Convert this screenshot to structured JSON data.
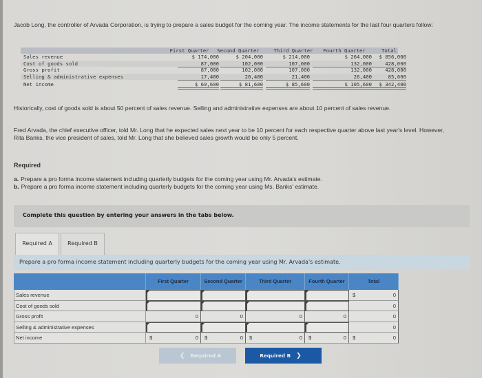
{
  "intro": "Jacob Long, the controller of Arvada Corporation, is trying to prepare a sales budget for the coming year. The income statements for the last four quarters follow:",
  "history_table": {
    "headers": [
      "First Quarter",
      "Second Quarter",
      "Third Quarter",
      "Fourth Quarter",
      "Total"
    ],
    "rows": [
      {
        "label": "Sales revenue",
        "values": [
          "$ 174,000",
          "$ 204,000",
          "$ 214,000",
          "$ 264,000",
          "$ 856,000"
        ]
      },
      {
        "label": "Cost of goods sold",
        "values": [
          "87,000",
          "102,000",
          "107,000",
          "132,000",
          "428,000"
        ]
      },
      {
        "label": "Gross profit",
        "values": [
          "87,000",
          "102,000",
          "107,000",
          "132,000",
          "428,000"
        ]
      },
      {
        "label": "Selling & administrative expenses",
        "values": [
          "17,400",
          "20,400",
          "21,400",
          "26,400",
          "85,600"
        ]
      },
      {
        "label": "Net income",
        "values": [
          "$ 69,600",
          "$ 81,600",
          "$ 85,600",
          "$ 105,600",
          "$ 342,400"
        ]
      }
    ]
  },
  "historical_note": "Historically, cost of goods sold is about 50 percent of sales revenue. Selling and administrative expenses are about 10 percent of sales revenue.",
  "fred_note": "Fred Arvada, the chief executive officer, told Mr. Long that he expected sales next year to be 10 percent for each respective quarter above last year's level. However, Rita Banks, the vice president of sales, told Mr. Long that she believed sales growth would be only 5 percent.",
  "required": {
    "heading": "Required",
    "items": [
      {
        "label": "a.",
        "text": "Prepare a pro forma income statement including quarterly budgets for the coming year using Mr. Arvada's estimate."
      },
      {
        "label": "b.",
        "text": "Prepare a pro forma income statement including quarterly budgets for the coming year using Ms. Banks' estimate."
      }
    ]
  },
  "complete_instruction": "Complete this question by entering your answers in the tabs below.",
  "tabs": [
    {
      "label": "Required A",
      "active": true
    },
    {
      "label": "Required B",
      "active": false
    }
  ],
  "tab_description": "Prepare a pro forma income statement including quarterly budgets for the coming year using Mr. Arvada's estimate.",
  "answer_table": {
    "headers": [
      "First Quarter",
      "Second Quarter",
      "Third Quarter",
      "Fourth Quarter",
      "Total"
    ],
    "rows": [
      {
        "label": "Sales revenue",
        "cells": [
          "",
          "",
          "",
          "",
          "0"
        ],
        "total_dollar": "$"
      },
      {
        "label": "Cost of goods sold",
        "cells": [
          "",
          "",
          "",
          "",
          "0"
        ]
      },
      {
        "label": "Gross profit",
        "cells": [
          "0",
          "0",
          "0",
          "0",
          "0"
        ]
      },
      {
        "label": "Selling & administrative expenses",
        "cells": [
          "",
          "",
          "",
          "",
          "0"
        ]
      },
      {
        "label": "Net income",
        "cells": [
          "0",
          "0",
          "0",
          "0",
          "0"
        ],
        "dollar": "$"
      }
    ]
  },
  "nav": {
    "prev_label": "Required A",
    "next_label": "Required B",
    "prev_icon": "chevron-left-icon",
    "next_icon": "chevron-right-icon"
  }
}
